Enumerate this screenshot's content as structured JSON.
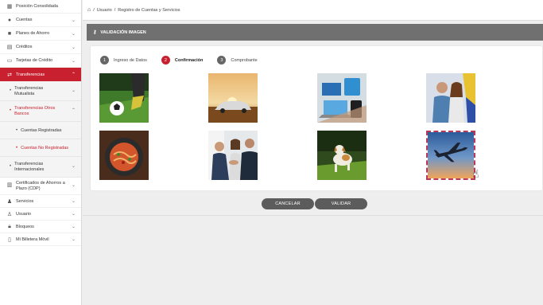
{
  "breadcrumb": {
    "items": [
      "Usuario",
      "Registro de Cuentas y Servicios"
    ],
    "separator": "/"
  },
  "sidebar": {
    "items": [
      {
        "label": "Posición Consolidada",
        "icon": "dashboard-icon"
      },
      {
        "label": "Cuentas",
        "icon": "accounts-icon"
      },
      {
        "label": "Planes de Ahorro",
        "icon": "savings-icon"
      },
      {
        "label": "Créditos",
        "icon": "credit-icon"
      },
      {
        "label": "Tarjetas de Crédito",
        "icon": "card-icon"
      },
      {
        "label": "Transferencias",
        "icon": "transfer-icon"
      }
    ],
    "transfer_sub": [
      {
        "label": "Transferencias Mutualista"
      },
      {
        "label": "Transferencias Otros Bancos"
      }
    ],
    "otros_bancos_sub": [
      {
        "label": "Cuentas Registradas"
      },
      {
        "label": "Cuentas No Registradas"
      }
    ],
    "transfer_sub_end": {
      "label": "Transferencias Internacionales"
    },
    "items_after": [
      {
        "label": "Certificados de Ahorros a Plazo (CDP)",
        "icon": "certificate-icon"
      },
      {
        "label": "Servicios",
        "icon": "services-icon"
      },
      {
        "label": "Usuario",
        "icon": "user-icon"
      },
      {
        "label": "Bloqueos",
        "icon": "lock-icon"
      },
      {
        "label": "Mi Billetera Móvil",
        "icon": "mobile-icon"
      }
    ]
  },
  "panel": {
    "title": "VALIDACIÓN IMAGEN"
  },
  "steps": [
    {
      "num": "1",
      "label": "Ingreso de Datos"
    },
    {
      "num": "2",
      "label": "Confirmación"
    },
    {
      "num": "3",
      "label": "Comprobante"
    }
  ],
  "images": [
    {
      "name": "soccer-image"
    },
    {
      "name": "car-sunset-image"
    },
    {
      "name": "devices-image"
    },
    {
      "name": "couple-image"
    },
    {
      "name": "pasta-image"
    },
    {
      "name": "business-handshake-image"
    },
    {
      "name": "dog-image"
    },
    {
      "name": "airplane-image",
      "selected": true
    }
  ],
  "buttons": {
    "cancel": "CANCELAR",
    "validate": "VALIDAR"
  },
  "colors": {
    "accent": "#c8202e",
    "header": "#707070",
    "button": "#5c5c5c"
  }
}
